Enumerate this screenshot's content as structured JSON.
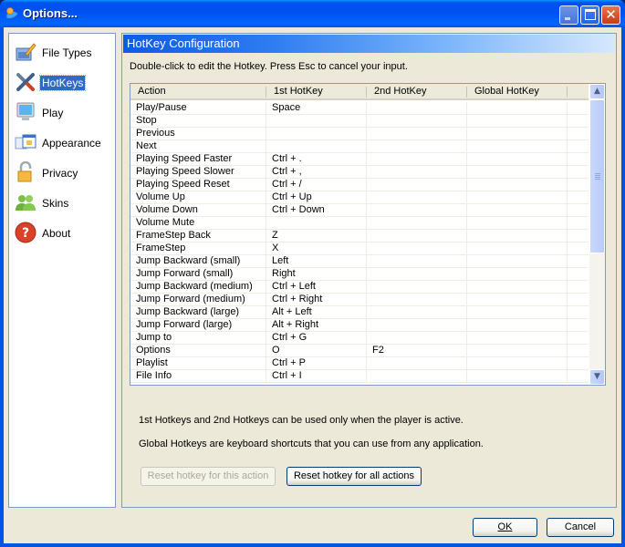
{
  "window": {
    "title": "Options...",
    "controls": {
      "minimize": "minimize",
      "maximize": "maximize",
      "close": "close"
    }
  },
  "sidebar": {
    "items": [
      {
        "label": "File Types",
        "icon": "file-types-icon",
        "selected": false
      },
      {
        "label": "HotKeys",
        "icon": "hotkeys-tools-icon",
        "selected": true
      },
      {
        "label": "Play",
        "icon": "monitor-icon",
        "selected": false
      },
      {
        "label": "Appearance",
        "icon": "appearance-window-icon",
        "selected": false
      },
      {
        "label": "Privacy",
        "icon": "padlock-icon",
        "selected": false
      },
      {
        "label": "Skins",
        "icon": "users-icon",
        "selected": false
      },
      {
        "label": "About",
        "icon": "help-question-icon",
        "selected": false
      }
    ]
  },
  "panel": {
    "title": "HotKey Configuration",
    "hint": "Double-click to edit the Hotkey. Press Esc to cancel your input.",
    "table": {
      "columns": [
        "Action",
        "1st HotKey",
        "2nd HotKey",
        "Global HotKey"
      ],
      "rows": [
        [
          "Play/Pause",
          "Space",
          "",
          ""
        ],
        [
          "Stop",
          "",
          "",
          ""
        ],
        [
          "Previous",
          "",
          "",
          ""
        ],
        [
          "Next",
          "",
          "",
          ""
        ],
        [
          "Playing Speed Faster",
          "Ctrl + .",
          "",
          ""
        ],
        [
          "Playing Speed Slower",
          "Ctrl + ,",
          "",
          ""
        ],
        [
          "Playing Speed Reset",
          "Ctrl + /",
          "",
          ""
        ],
        [
          "Volume Up",
          "Ctrl + Up",
          "",
          ""
        ],
        [
          "Volume Down",
          "Ctrl + Down",
          "",
          ""
        ],
        [
          "Volume Mute",
          "",
          "",
          ""
        ],
        [
          "FrameStep Back",
          "Z",
          "",
          ""
        ],
        [
          "FrameStep",
          "X",
          "",
          ""
        ],
        [
          "Jump Backward (small)",
          "Left",
          "",
          ""
        ],
        [
          "Jump Forward (small)",
          "Right",
          "",
          ""
        ],
        [
          "Jump Backward (medium)",
          "Ctrl + Left",
          "",
          ""
        ],
        [
          "Jump Forward (medium)",
          "Ctrl + Right",
          "",
          ""
        ],
        [
          "Jump Backward (large)",
          "Alt + Left",
          "",
          ""
        ],
        [
          "Jump Forward (large)",
          "Alt + Right",
          "",
          ""
        ],
        [
          "Jump to",
          "Ctrl + G",
          "",
          ""
        ],
        [
          "Options",
          "O",
          "F2",
          ""
        ],
        [
          "Playlist",
          "Ctrl + P",
          "",
          ""
        ],
        [
          "File Info",
          "Ctrl + I",
          "",
          ""
        ]
      ]
    },
    "note1": "1st Hotkeys and 2nd Hotkeys can be used only when the player is active.",
    "note2": "Global Hotkeys are keyboard shortcuts that you can use from any application.",
    "reset_this_label": "Reset hotkey for this action",
    "reset_all_label": "Reset hotkey for all actions"
  },
  "footer": {
    "ok_label": "OK",
    "cancel_label": "Cancel"
  }
}
